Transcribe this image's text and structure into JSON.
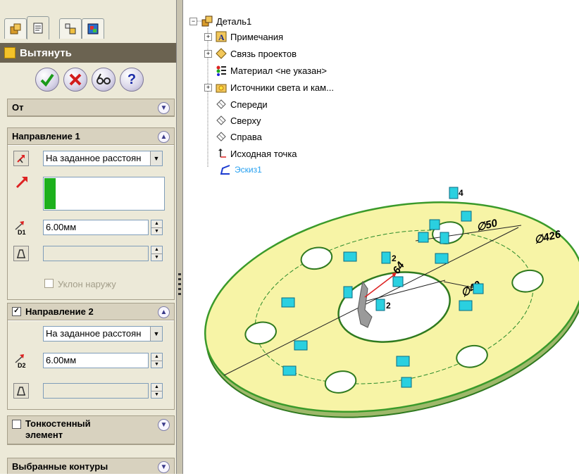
{
  "property_manager": {
    "title": "Вытянуть",
    "tabs": [
      "feature-manager-tab",
      "property-manager-tab",
      "configuration-manager-tab",
      "dim-expert-tab"
    ],
    "actions": [
      "ok",
      "cancel",
      "preview",
      "help"
    ],
    "from": {
      "label": "От"
    },
    "direction1": {
      "label": "Направление 1",
      "end_condition": "На заданное расстоян",
      "depth_value": "6.00мм",
      "depth_icon_label": "D1",
      "draft_value": "",
      "draft_outward_label": "Уклон наружу"
    },
    "direction2": {
      "label": "Направление 2",
      "checked": true,
      "end_condition": "На заданное расстоян",
      "depth_value": "6.00мм",
      "depth_icon_label": "D2",
      "draft_value": ""
    },
    "thin_feature": {
      "label_line1": "Тонкостенный",
      "label_line2": "элемент",
      "checked": false
    },
    "selected_contours": {
      "label": "Выбранные контуры"
    }
  },
  "tree": {
    "root": "Деталь1",
    "items": [
      {
        "label": "Примечания",
        "icon": "annotations-icon",
        "expandable": true
      },
      {
        "label": "Связь проектов",
        "icon": "design-binder-icon",
        "expandable": true
      },
      {
        "label": "Материал <не указан>",
        "icon": "material-icon",
        "expandable": false
      },
      {
        "label": "Источники света и кам...",
        "icon": "lights-cameras-icon",
        "expandable": true
      },
      {
        "label": "Спереди",
        "icon": "plane-icon",
        "expandable": false
      },
      {
        "label": "Сверху",
        "icon": "plane-icon",
        "expandable": false
      },
      {
        "label": "Справа",
        "icon": "plane-icon",
        "expandable": false
      },
      {
        "label": "Исходная точка",
        "icon": "origin-icon",
        "expandable": false
      },
      {
        "label": "Эскиз1",
        "icon": "sketch-icon",
        "expandable": false,
        "active": true
      }
    ]
  },
  "viewport": {
    "dimensions": [
      "∅50",
      "∅426",
      "∅40",
      "64"
    ],
    "relation_labels": [
      "4",
      "2",
      "2"
    ],
    "colors": {
      "part_face": "#f7f4a6",
      "part_edge": "#3a9a2a",
      "sketch_line": "#2a8a2a",
      "relation_badge": "#2ad0e0"
    }
  }
}
